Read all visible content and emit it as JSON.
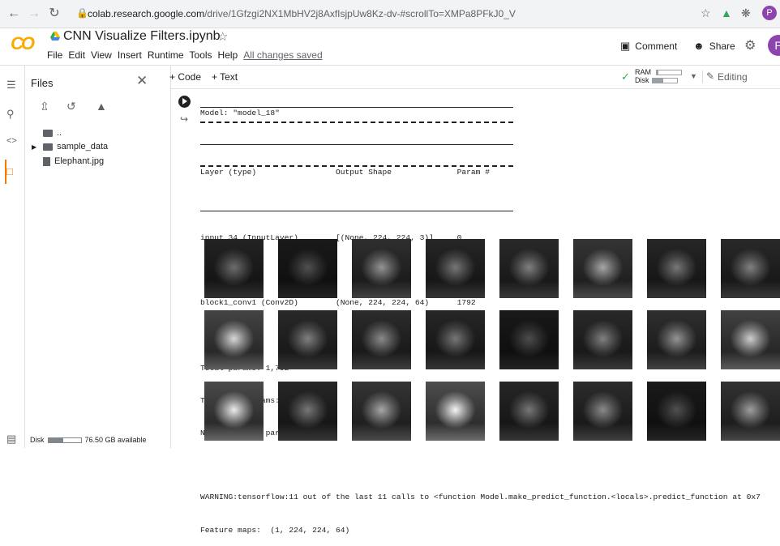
{
  "browser": {
    "url_host": "colab.research.google.com",
    "url_path": "/drive/1Gfzgi2NX1MbHV2j8AxfIsjpUw8Kz-dv-#scrollTo=XMPa8PFkJ0_V",
    "profile_initial": "P"
  },
  "header": {
    "logo": "CO",
    "title": "CNN Visualize Filters.ipynb",
    "menu": [
      "File",
      "Edit",
      "View",
      "Insert",
      "Runtime",
      "Tools",
      "Help"
    ],
    "saved_status": "All changes saved",
    "comment_label": "Comment",
    "share_label": "Share",
    "avatar_initial": "P"
  },
  "files": {
    "title": "Files",
    "items": [
      {
        "name": "..",
        "type": "folder"
      },
      {
        "name": "sample_data",
        "type": "folder"
      },
      {
        "name": "Elephant.jpg",
        "type": "file"
      }
    ],
    "disk_label": "Disk",
    "disk_available": "76.50 GB available",
    "disk_used_fraction": 0.45
  },
  "toolbar": {
    "code_label": "+ Code",
    "text_label": "+ Text",
    "ram_label": "RAM",
    "disk_label": "Disk",
    "ram_fraction": 0.08,
    "disk_fraction": 0.45,
    "editing_label": "Editing"
  },
  "output": {
    "model_line": "Model: \"model_18\"",
    "table_header": "Layer (type)                 Output Shape              Param #",
    "rows": [
      "input_34 (InputLayer)        [(None, 224, 224, 3)]     0",
      "block1_conv1 (Conv2D)        (None, 224, 224, 64)      1792"
    ],
    "total_params": "Total params: 1,792",
    "trainable_params": "Trainable params: 1,792",
    "non_trainable_params": "Non-trainable params: 0",
    "warning": "WARNING:tensorflow:11 out of the last 11 calls to <function Model.make_predict_function.<locals>.predict_function at 0x7",
    "feature_maps": "Feature maps:  (1, 224, 224, 64)"
  },
  "feature_maps": {
    "rows": 3,
    "cols": 8,
    "brightness": [
      [
        0.25,
        0.1,
        0.45,
        0.3,
        0.35,
        0.55,
        0.3,
        0.35
      ],
      [
        0.8,
        0.35,
        0.4,
        0.3,
        0.08,
        0.35,
        0.45,
        0.75
      ],
      [
        0.9,
        0.3,
        0.55,
        0.95,
        0.3,
        0.4,
        0.1,
        0.5
      ]
    ]
  }
}
